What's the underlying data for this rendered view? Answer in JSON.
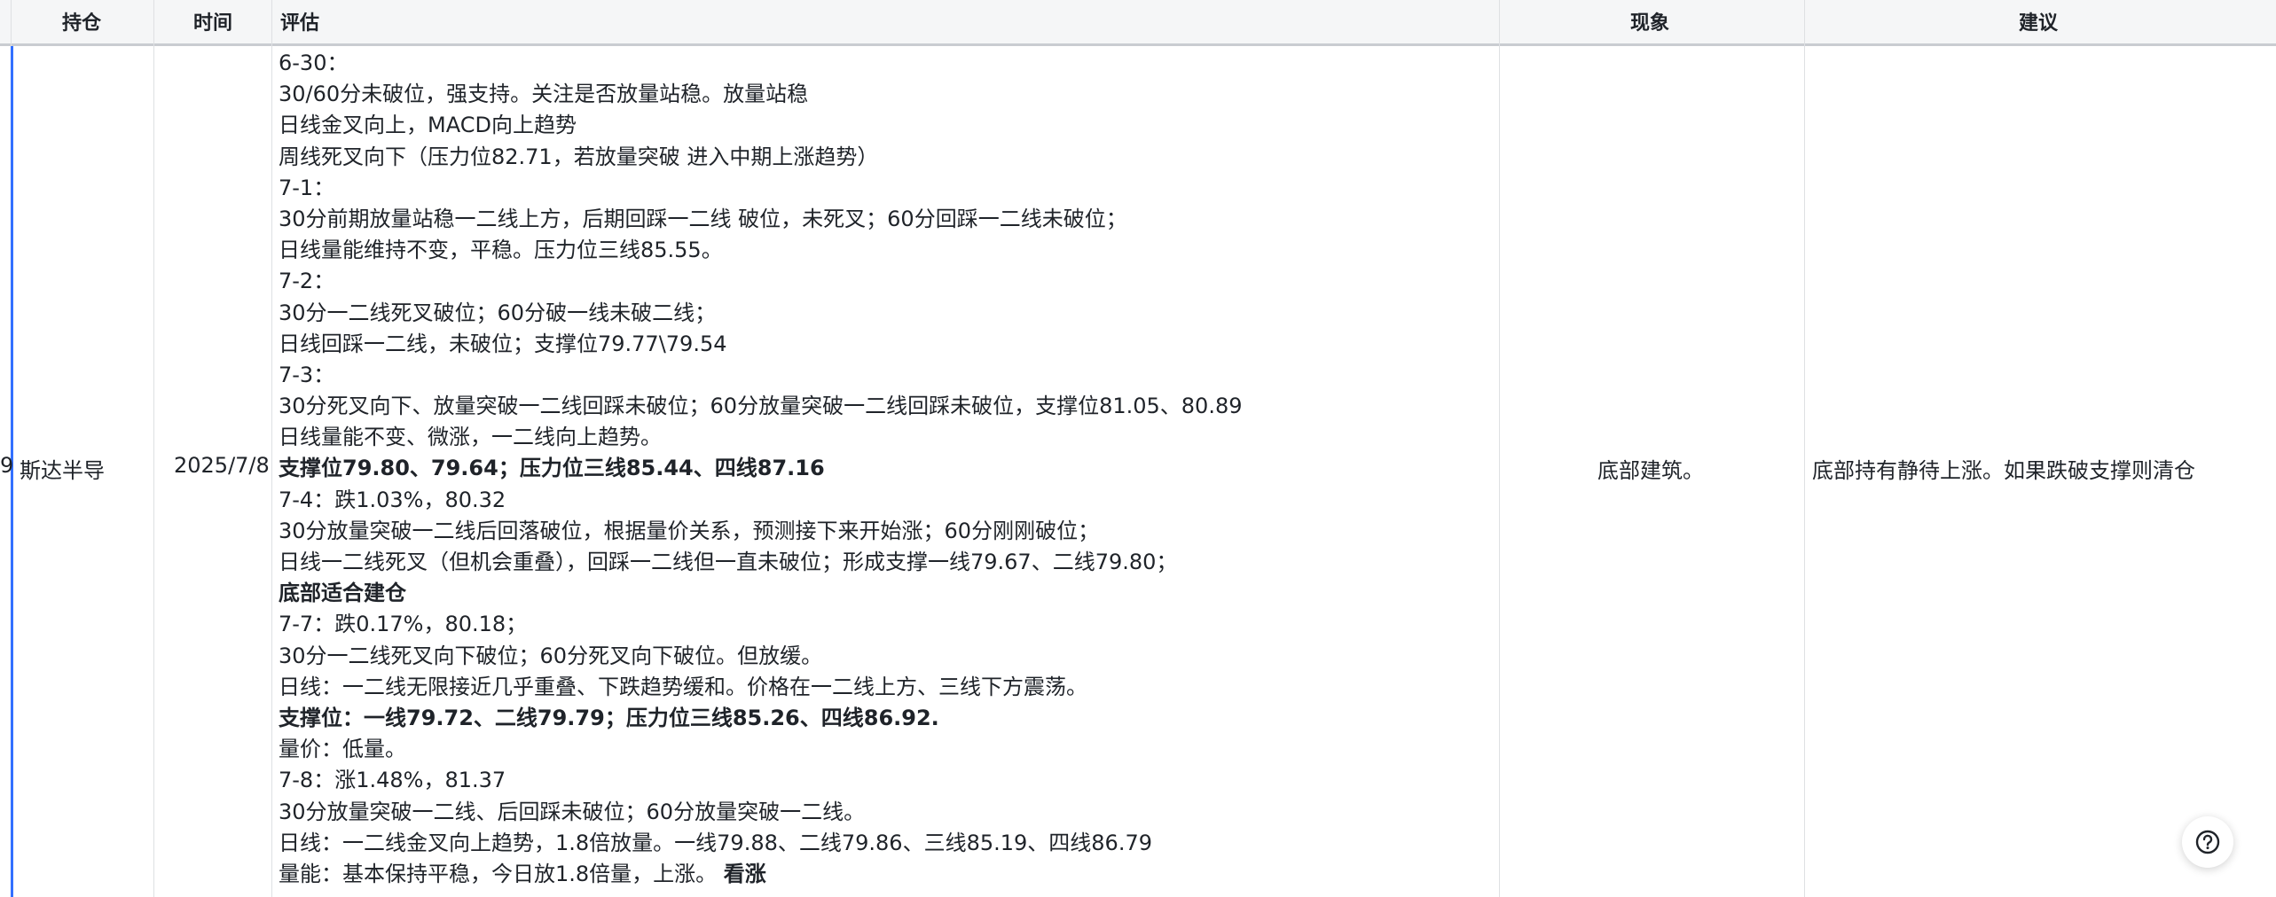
{
  "table": {
    "headers": {
      "holding": "持仓",
      "time": "时间",
      "evaluation": "评估",
      "phenomenon": "现象",
      "suggestion": "建议"
    },
    "row": {
      "row_number_fragment": "9",
      "holding": "斯达半导",
      "time": "2025/7/8",
      "phenomenon": "底部建筑。",
      "suggestion": "底部持有静待上涨。如果跌破支撑则清仓",
      "evaluation_lines": [
        {
          "text": "6-30：",
          "bold": false
        },
        {
          "text": "30/60分未破位，强支持。关注是否放量站稳。放量站稳",
          "bold": false
        },
        {
          "text": "日线金叉向上，MACD向上趋势",
          "bold": false
        },
        {
          "text": "周线死叉向下（压力位82.71，若放量突破 进入中期上涨趋势）",
          "bold": false
        },
        {
          "text": "7-1：",
          "bold": false
        },
        {
          "text": "30分前期放量站稳一二线上方，后期回踩一二线 破位，未死叉；60分回踩一二线未破位；",
          "bold": false
        },
        {
          "text": "日线量能维持不变，平稳。压力位三线85.55。",
          "bold": false
        },
        {
          "text": "7-2：",
          "bold": false
        },
        {
          "text": "30分一二线死叉破位；60分破一线未破二线；",
          "bold": false
        },
        {
          "text": "日线回踩一二线，未破位；支撑位79.77\\79.54",
          "bold": false
        },
        {
          "text": "7-3：",
          "bold": false
        },
        {
          "text": "30分死叉向下、放量突破一二线回踩未破位；60分放量突破一二线回踩未破位，支撑位81.05、80.89",
          "bold": false
        },
        {
          "text": "日线量能不变、微涨，一二线向上趋势。",
          "bold": false
        },
        {
          "text": "支撑位79.80、79.64；压力位三线85.44、四线87.16",
          "bold": true
        },
        {
          "text": "7-4：跌1.03%，80.32",
          "bold": false
        },
        {
          "text": "30分放量突破一二线后回落破位，根据量价关系，预测接下来开始涨；60分刚刚破位；",
          "bold": false
        },
        {
          "text": "日线一二线死叉（但机会重叠），回踩一二线但一直未破位；形成支撑一线79.67、二线79.80；",
          "bold": false
        },
        {
          "text": "底部适合建仓",
          "bold": true
        },
        {
          "text": "7-7：跌0.17%，80.18；",
          "bold": false
        },
        {
          "text": "30分一二线死叉向下破位；60分死叉向下破位。但放缓。",
          "bold": false
        },
        {
          "text": "日线：一二线无限接近几乎重叠、下跌趋势缓和。价格在一二线上方、三线下方震荡。",
          "bold": false
        },
        {
          "text": "支撑位：一线79.72、二线79.79；压力位三线85.26、四线86.92.",
          "bold": true
        },
        {
          "text": "量价：低量。",
          "bold": false
        },
        {
          "text": "7-8：涨1.48%，81.37",
          "bold": false
        },
        {
          "text": "30分放量突破一二线、后回踩未破位；60分放量突破一二线。",
          "bold": false
        },
        {
          "text": "日线：一二线金叉向上趋势，1.8倍放量。一线79.88、二线79.86、三线85.19、四线86.79",
          "bold": false
        }
      ],
      "last_line": {
        "normal": "量能：基本保持平稳，今日放1.8倍量，上涨。 ",
        "bold": "看涨"
      }
    }
  },
  "help_button": {
    "icon": "question-circle-icon"
  },
  "colors": {
    "accent": "#3370ff",
    "header_bg": "#f5f6f7",
    "grid": "#dee0e3"
  }
}
